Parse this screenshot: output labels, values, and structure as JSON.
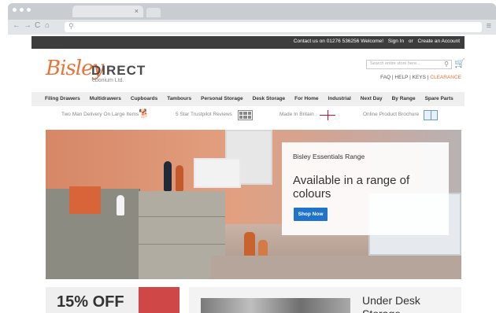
{
  "browser": {
    "tab_close": "×",
    "nav_buttons": [
      "←",
      "→",
      "C",
      "⌂"
    ],
    "menu": "≡"
  },
  "topbar": {
    "contact": "Contact us on 01276 536256",
    "welcome": "Welcome!",
    "sign_in": "Sign In",
    "or": "or",
    "create_account": "Create an Account"
  },
  "header": {
    "logo_script": "Bisley",
    "logo_direct": "DIRECT",
    "logo_sub": "ebonium Ltd.",
    "search_placeholder": "Search entire store here...",
    "links": {
      "faq": "FAQ",
      "help": "HELP",
      "keys": "KEYS",
      "clearance": "CLEARANCE",
      "sep": " | "
    }
  },
  "categories": [
    "Filing Drawers",
    "Multidrawers",
    "Cupboards",
    "Tambours",
    "Personal Storage",
    "Desk Storage",
    "For Home",
    "Industrial",
    "Next Day",
    "By Range",
    "Spare Parts"
  ],
  "features": {
    "delivery": "Two Man Delivery On Large Items",
    "trustpilot": "5 Star Trustpilot Reviews",
    "britain": "Made In Britain",
    "brochure": "Online Product Brochure"
  },
  "hero": {
    "subtitle": "Bisley Essentials Range",
    "title": "Available in a range of colours",
    "button": "Shop Now"
  },
  "promos": {
    "left": "15% OFF",
    "right": "Under Desk Storage"
  },
  "colors": {
    "accent": "#e8743a",
    "button": "#1f73c9",
    "topbar": "#3d3d3d"
  }
}
